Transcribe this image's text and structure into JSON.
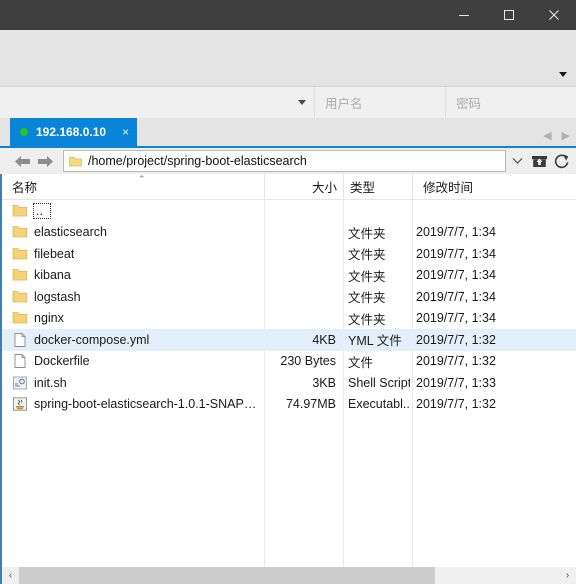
{
  "window": {
    "controls": {
      "minimize": "minimize-button",
      "maximize": "maximize-button",
      "close": "close-button"
    }
  },
  "toolbar": {
    "overflow_label": "▼"
  },
  "connection": {
    "host_dropdown_caret": "▼",
    "username_placeholder": "用户名",
    "username_value": "",
    "password_placeholder": "密码",
    "password_value": ""
  },
  "tabs": {
    "items": [
      {
        "label": "192.168.0.10",
        "status_color": "#27c327",
        "close_label": "×",
        "active": true
      }
    ],
    "prev_label": "◀",
    "next_label": "▶"
  },
  "address_bar": {
    "back_label": "back-arrow",
    "forward_label": "forward-arrow",
    "path": "/home/project/spring-boot-elasticsearch",
    "dropdown_label": "∨",
    "upload_label": "upload-icon",
    "refresh_label": "refresh-icon"
  },
  "file_list": {
    "columns": [
      {
        "key": "name",
        "label": "名称"
      },
      {
        "key": "size",
        "label": "大小"
      },
      {
        "key": "type",
        "label": "类型"
      },
      {
        "key": "date",
        "label": "修改时间"
      }
    ],
    "sort_caret": "⌃",
    "rows": [
      {
        "name": "..",
        "icon": "folder-icon",
        "size": "",
        "type": "",
        "date": "",
        "selected": false,
        "focused": true
      },
      {
        "name": "elasticsearch",
        "icon": "folder-icon",
        "size": "",
        "type": "文件夹",
        "date": "2019/7/7, 1:34",
        "selected": false,
        "focused": false
      },
      {
        "name": "filebeat",
        "icon": "folder-icon",
        "size": "",
        "type": "文件夹",
        "date": "2019/7/7, 1:34",
        "selected": false,
        "focused": false
      },
      {
        "name": "kibana",
        "icon": "folder-icon",
        "size": "",
        "type": "文件夹",
        "date": "2019/7/7, 1:34",
        "selected": false,
        "focused": false
      },
      {
        "name": "logstash",
        "icon": "folder-icon",
        "size": "",
        "type": "文件夹",
        "date": "2019/7/7, 1:34",
        "selected": false,
        "focused": false
      },
      {
        "name": "nginx",
        "icon": "folder-icon",
        "size": "",
        "type": "文件夹",
        "date": "2019/7/7, 1:34",
        "selected": false,
        "focused": false
      },
      {
        "name": "docker-compose.yml",
        "icon": "file-icon",
        "size": "4KB",
        "type": "YML 文件",
        "date": "2019/7/7, 1:32",
        "selected": true,
        "focused": false
      },
      {
        "name": "Dockerfile",
        "icon": "file-icon",
        "size": "230 Bytes",
        "type": "文件",
        "date": "2019/7/7, 1:32",
        "selected": false,
        "focused": false
      },
      {
        "name": "init.sh",
        "icon": "shell-script-icon",
        "size": "3KB",
        "type": "Shell Script",
        "date": "2019/7/7, 1:33",
        "selected": false,
        "focused": false
      },
      {
        "name": "spring-boot-elasticsearch-1.0.1-SNAPS...",
        "icon": "java-jar-icon",
        "size": "74.97MB",
        "type": "Executabl...",
        "date": "2019/7/7, 1:32",
        "selected": false,
        "focused": false
      }
    ]
  },
  "scrollbar": {
    "left_label": "‹",
    "right_label": "›"
  },
  "colors": {
    "titlebar": "#3f3f3f",
    "accent": "#0a84d8",
    "selection": "#e3f0fb",
    "status_online": "#27c327",
    "folder": "#f5d273"
  }
}
